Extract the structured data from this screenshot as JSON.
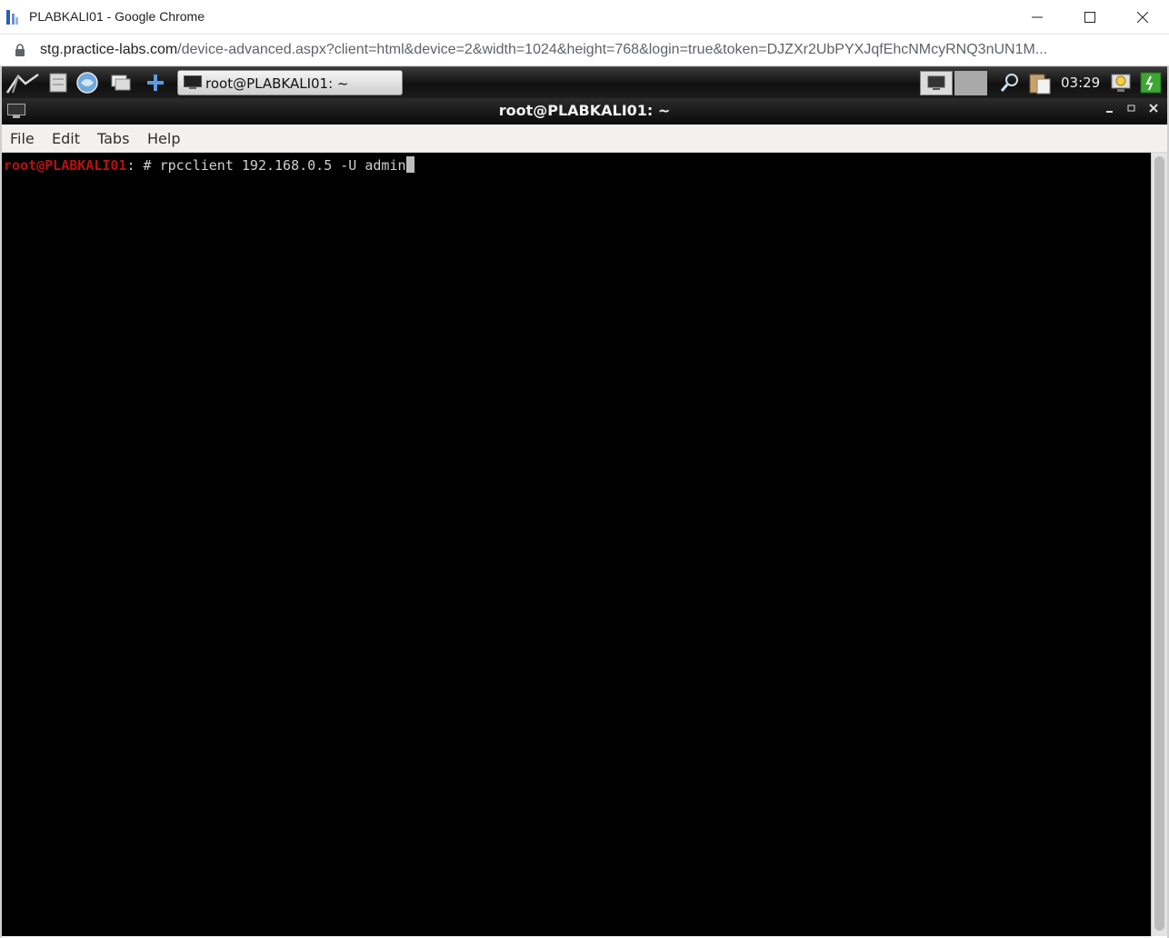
{
  "browser": {
    "window_title": "PLABKALI01 - Google Chrome",
    "url_host": "stg.practice-labs.com",
    "url_path": "/device-advanced.aspx?client=html&device=2&width=1024&height=768&login=true&token=DJZXr2UbPYXJqfEhcNMcyRNQ3nUN1M..."
  },
  "panel": {
    "icons": [
      "kali-menu-icon",
      "file-manager-icon",
      "browser-icon",
      "show-desktop-icon",
      "add-icon"
    ],
    "taskbar_label": "root@PLABKALI01: ~",
    "clock": "03:29"
  },
  "terminal": {
    "title": "root@PLABKALI01: ~",
    "menu": [
      "File",
      "Edit",
      "Tabs",
      "Help"
    ],
    "prompt_user": "root@PLABKALI01",
    "prompt_suffix": ": # ",
    "command": "rpcclient 192.168.0.5 -U admin",
    "colors": {
      "prompt": "#b81010",
      "text": "#cfcfcf",
      "background": "#000000"
    }
  }
}
